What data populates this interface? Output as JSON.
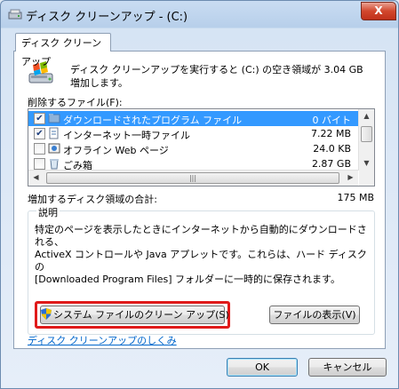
{
  "window": {
    "title": "ディスク クリーンアップ - (C:)",
    "close_label": "X"
  },
  "tab": {
    "label": "ディスク クリーンアップ"
  },
  "intro_text": "ディスク クリーンアップを実行すると (C:) の空き領域が 3.04 GB 増加します。",
  "files_label": "削除するファイル(F):",
  "files": [
    {
      "checked": true,
      "icon": "folder-icon",
      "name": "ダウンロードされたプログラム ファイル",
      "size": "0 バイト",
      "selected": true
    },
    {
      "checked": true,
      "icon": "page-icon",
      "name": "インターネット一時ファイル",
      "size": "7.22 MB",
      "selected": false
    },
    {
      "checked": false,
      "icon": "offline-web-icon",
      "name": "オフライン Web ページ",
      "size": "24.0 KB",
      "selected": false
    },
    {
      "checked": false,
      "icon": "recycle-bin-icon",
      "name": "ごみ箱",
      "size": "2.87 GB",
      "selected": false
    }
  ],
  "total": {
    "label": "増加するディスク領域の合計:",
    "value": "175 MB"
  },
  "description": {
    "title": "説明",
    "text": "特定のページを表示したときにインターネットから自動的にダウンロードされる、\nActiveX コントロールや Java アプレットです。これらは、ハード ディスクの\n[Downloaded Program Files] フォルダーに一時的に保存されます。"
  },
  "buttons": {
    "cleanup_system": "システム ファイルのクリーン アップ(S)",
    "view_files": "ファイルの表示(V)",
    "ok": "OK",
    "cancel": "キャンセル"
  },
  "help_link": "ディスク クリーンアップのしくみ",
  "colors": {
    "highlight": "#e01a1a",
    "selection": "#3399ff",
    "link": "#0066cc"
  }
}
